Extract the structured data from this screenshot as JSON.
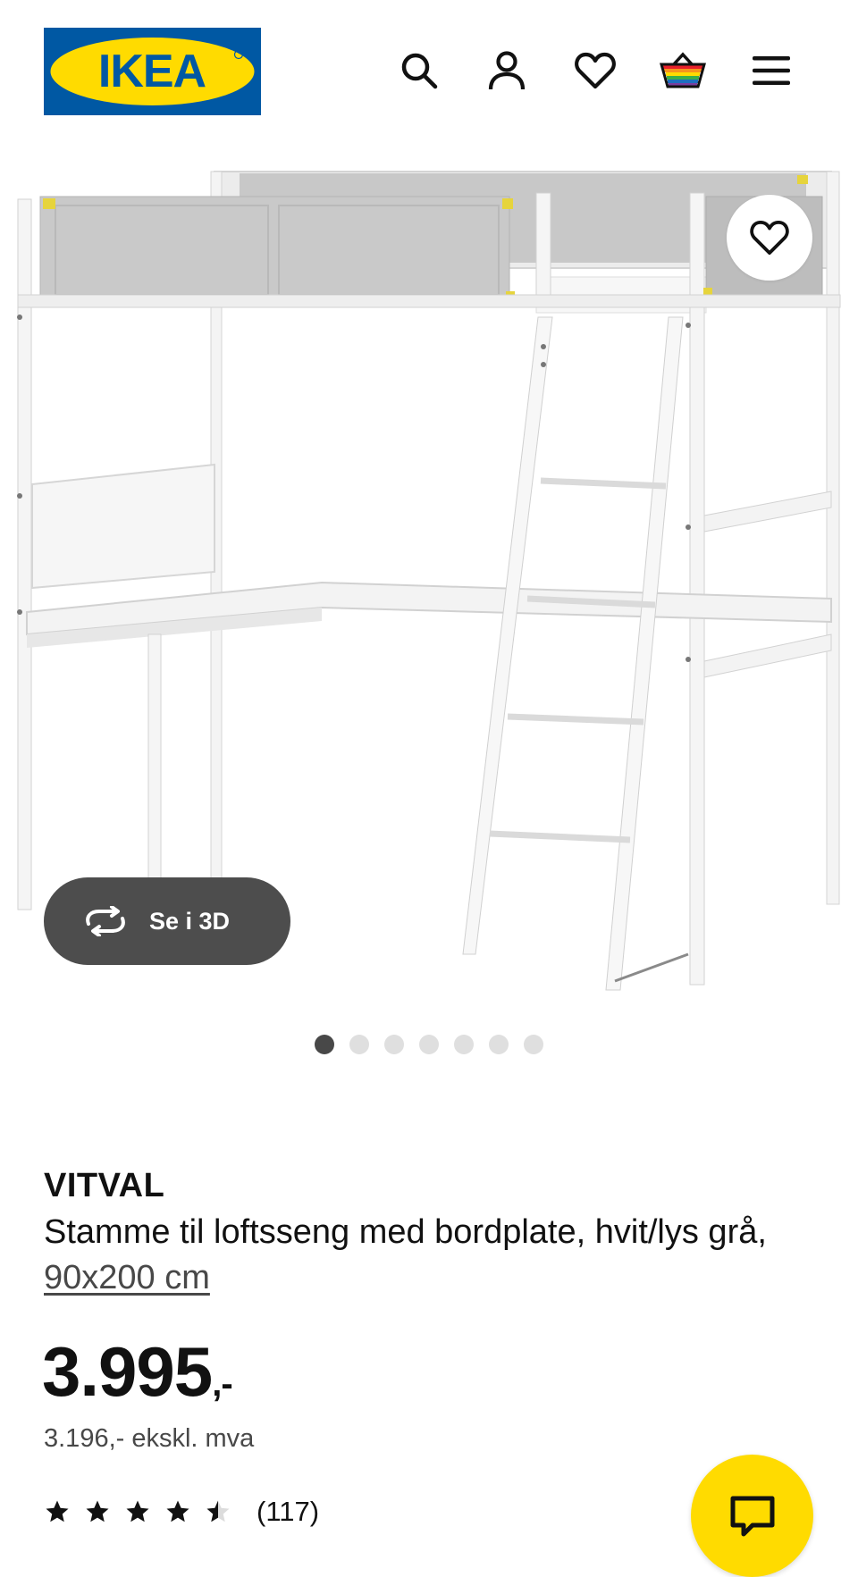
{
  "header": {
    "logo_text": "IKEA",
    "icons": [
      "search-icon",
      "account-icon",
      "favourites-icon",
      "cart-icon",
      "menu-icon"
    ]
  },
  "gallery": {
    "favourite_icon": "heart-outline-icon",
    "view_3d_label": "Se i 3D",
    "view_3d_icon": "rotate-3d-icon",
    "image_count": 7,
    "active_index": 0
  },
  "product": {
    "brand": "VITVAL",
    "description": "Stamme til loftsseng med bordplate, hvit/lys grå,",
    "size_link": "90x200 cm",
    "price": "3.995",
    "price_suffix": ",-",
    "price_ex_vat": "3.196,- ekskl. mva",
    "rating": 4.5,
    "rating_max": 5,
    "review_count": "(117)"
  },
  "chat": {
    "icon": "chat-icon"
  },
  "colors": {
    "ikea_blue": "#0058a3",
    "ikea_yellow": "#ffdb00",
    "text": "#111111",
    "secondary_text": "#484848"
  }
}
